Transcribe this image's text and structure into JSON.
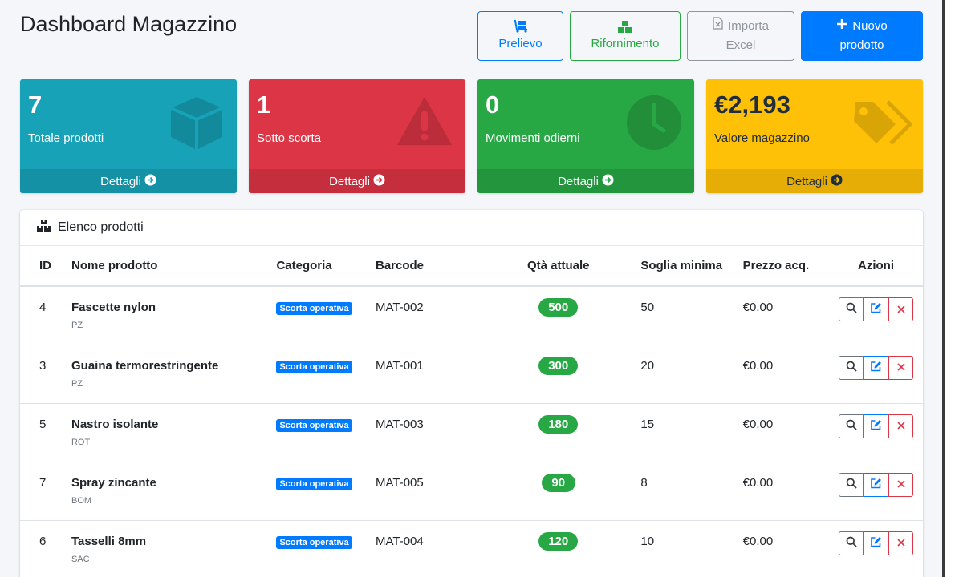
{
  "header": {
    "title": "Dashboard Magazzino",
    "prelievo_label": "Prelievo",
    "rifornimento_label": "Rifornimento",
    "importa_line1": "Importa",
    "importa_line2": "Excel",
    "nuovo_line1": "Nuovo",
    "nuovo_line2": "prodotto"
  },
  "stats": [
    {
      "value": "7",
      "label": "Totale prodotti",
      "link": "Dettagli",
      "color": "#17a2b8",
      "icon": "cube-icon"
    },
    {
      "value": "1",
      "label": "Sotto scorta",
      "link": "Dettagli",
      "color": "#dc3545",
      "icon": "warning-icon"
    },
    {
      "value": "0",
      "label": "Movimenti odierni",
      "link": "Dettagli",
      "color": "#28a745",
      "icon": "clock-icon"
    },
    {
      "value": "€2,193",
      "label": "Valore magazzino",
      "link": "Dettagli",
      "color": "#ffc107",
      "icon": "tags-icon"
    }
  ],
  "products_card": {
    "title": "Elenco prodotti",
    "columns": [
      "ID",
      "Nome prodotto",
      "Categoria",
      "Barcode",
      "Qtà attuale",
      "Soglia minima",
      "Prezzo acq.",
      "Azioni"
    ],
    "rows": [
      {
        "id": "4",
        "name": "Fascette nylon",
        "unit": "PZ",
        "category": "Scorta operativa",
        "barcode": "MAT-002",
        "qty": "500",
        "min": "50",
        "price": "€0.00"
      },
      {
        "id": "3",
        "name": "Guaina termorestringente",
        "unit": "PZ",
        "category": "Scorta operativa",
        "barcode": "MAT-001",
        "qty": "300",
        "min": "20",
        "price": "€0.00"
      },
      {
        "id": "5",
        "name": "Nastro isolante",
        "unit": "ROT",
        "category": "Scorta operativa",
        "barcode": "MAT-003",
        "qty": "180",
        "min": "15",
        "price": "€0.00"
      },
      {
        "id": "7",
        "name": "Spray zincante",
        "unit": "BOM",
        "category": "Scorta operativa",
        "barcode": "MAT-005",
        "qty": "90",
        "min": "8",
        "price": "€0.00"
      },
      {
        "id": "6",
        "name": "Tasselli 8mm",
        "unit": "SAC",
        "category": "Scorta operativa",
        "barcode": "MAT-004",
        "qty": "120",
        "min": "10",
        "price": "€0.00"
      }
    ]
  },
  "colors": {
    "primary": "#007bff",
    "success": "#28a745",
    "danger": "#dc3545",
    "info": "#17a2b8",
    "warning": "#ffc107"
  }
}
